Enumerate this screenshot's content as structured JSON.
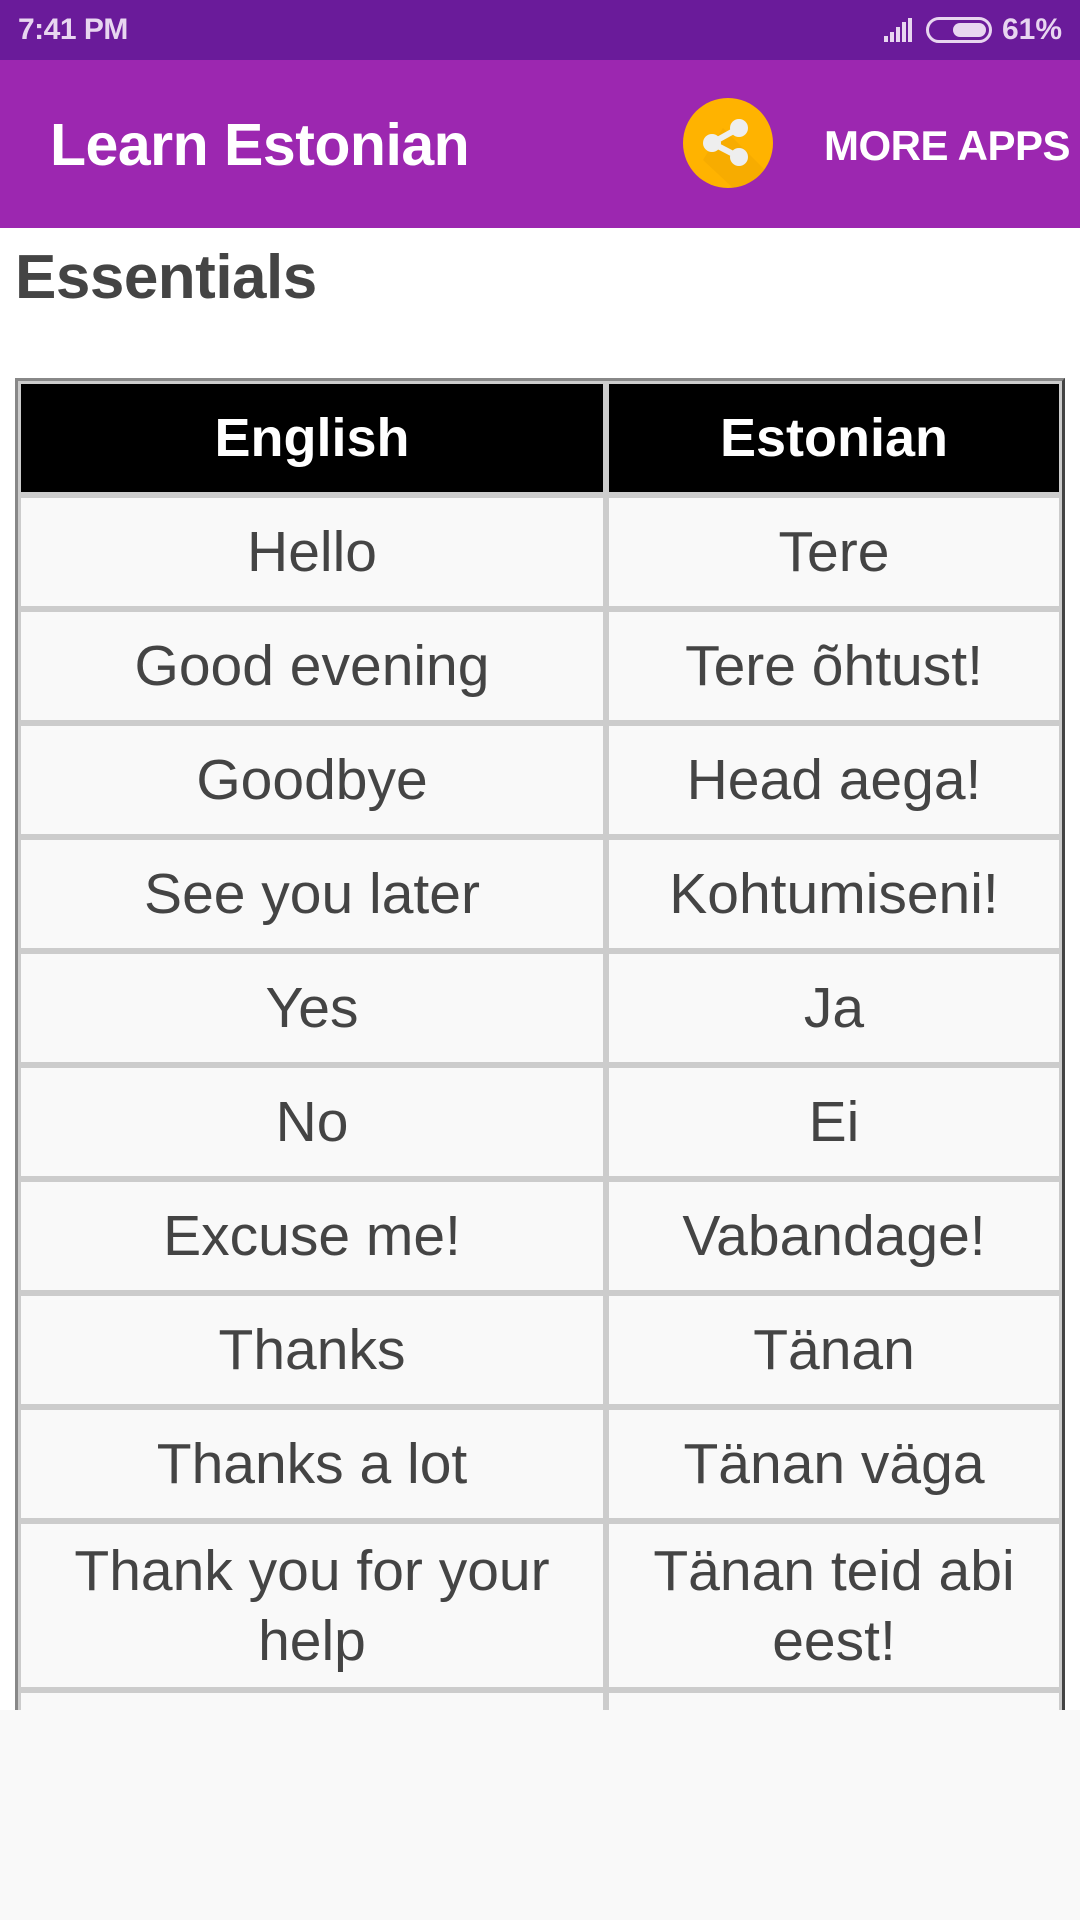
{
  "status_bar": {
    "time": "7:41 PM",
    "signal_icon": "signal-strength-icon",
    "battery_icon": "battery-icon",
    "battery_level_percent": 61,
    "battery_text": "61%"
  },
  "app_bar": {
    "title": "Learn Estonian",
    "share_icon": "share-icon",
    "share_color": "#FFB300",
    "more_apps_label": "MORE APPS",
    "color": "#9C27B0",
    "status_color": "#6A1B9A"
  },
  "content": {
    "section_title": "Essentials",
    "table": {
      "headers": [
        "English",
        "Estonian"
      ],
      "rows": [
        {
          "english": "Hello",
          "estonian": "Tere"
        },
        {
          "english": "Good evening",
          "estonian": "Tere õhtust!"
        },
        {
          "english": "Goodbye",
          "estonian": "Head aega!"
        },
        {
          "english": "See you later",
          "estonian": "Kohtumiseni!"
        },
        {
          "english": "Yes",
          "estonian": "Ja"
        },
        {
          "english": "No",
          "estonian": "Ei"
        },
        {
          "english": "Excuse me!",
          "estonian": "Vabandage!"
        },
        {
          "english": "Thanks",
          "estonian": "Tänan"
        },
        {
          "english": "Thanks a lot",
          "estonian": "Tänan väga"
        },
        {
          "english": "Thank you for your help",
          "estonian": "Tänan teid abi eest!"
        },
        {
          "english": "",
          "estonian": ""
        }
      ]
    }
  }
}
